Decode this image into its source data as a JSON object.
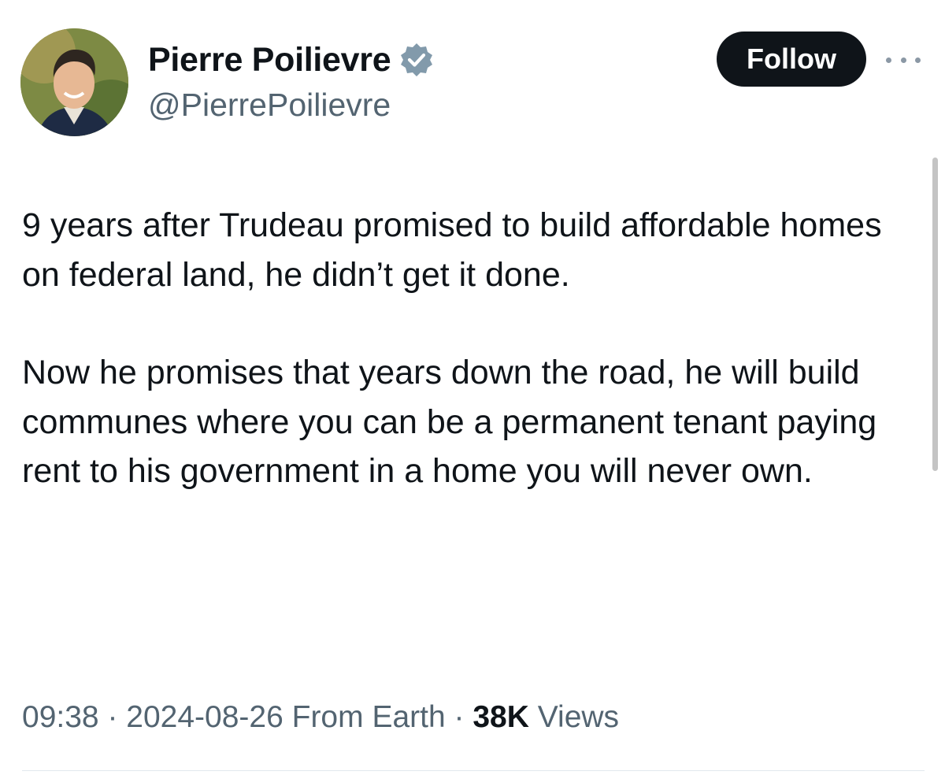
{
  "author": {
    "display_name": "Pierre Poilievre",
    "handle": "@PierrePoilievre",
    "verified_icon": "verified-badge-icon",
    "verified_color": "#829aab"
  },
  "actions": {
    "follow_label": "Follow",
    "more_icon": "more-options-icon"
  },
  "tweet": {
    "paragraphs": [
      "9 years after Trudeau promised to build affordable homes on federal land, he didn’t get it done.",
      "Now he promises that years down the road, he will build communes where you can be a permanent tenant paying rent to his government in a home you will never own."
    ]
  },
  "meta": {
    "time": "09:38",
    "date": "2024-08-26",
    "source": "From Earth",
    "views_count": "38K",
    "views_label": "Views"
  }
}
